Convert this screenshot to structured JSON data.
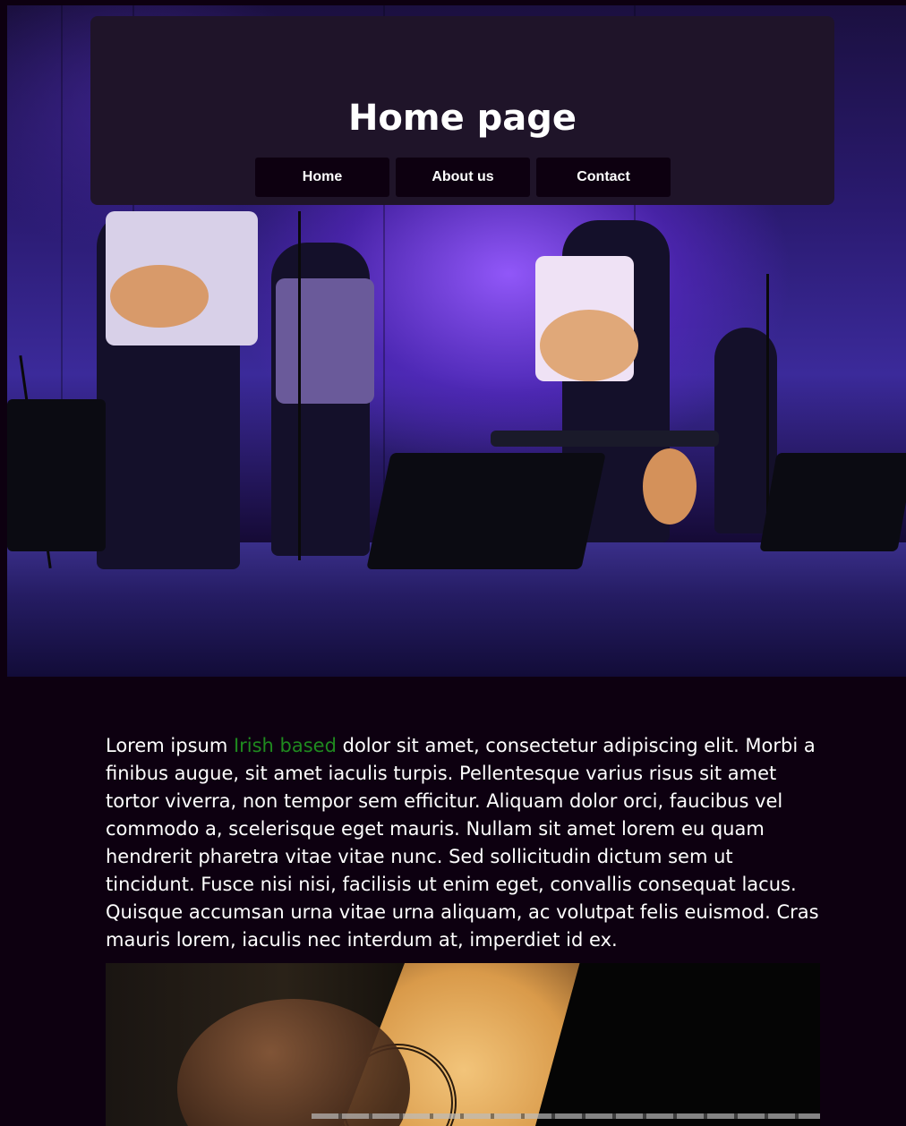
{
  "header": {
    "title": "Home page",
    "nav": [
      {
        "label": "Home"
      },
      {
        "label": "About us"
      },
      {
        "label": "Contact"
      }
    ]
  },
  "hero": {
    "image": "concert-band-on-stage-photo"
  },
  "content": {
    "text_before": "Lorem ipsum ",
    "highlight": "Irish based",
    "text_after": " dolor sit amet, consectetur adipiscing elit. Morbi a finibus augue, sit amet iaculis turpis. Pellentesque varius risus sit amet tortor viverra, non tempor sem efficitur. Aliquam dolor orci, faucibus vel commodo a, scelerisque eget mauris. Nullam sit amet lorem eu quam hendrerit pharetra vitae vitae nunc. Sed sollicitudin dictum sem ut tincidunt. Fusce nisi nisi, facilisis ut enim eget, convallis consequat lacus. Quisque accumsan urna vitae urna aliquam, ac volutpat felis euismod. Cras mauris lorem, iaculis nec interdum at, imperdiet id ex.",
    "highlight_color": "#1f8a1f"
  },
  "second_image": {
    "image": "acoustic-guitar-closeup-photo"
  },
  "colors": {
    "background": "#0d0010",
    "header_panel": "#1f1429",
    "nav_button": "#0d0010",
    "text": "#ffffff"
  }
}
